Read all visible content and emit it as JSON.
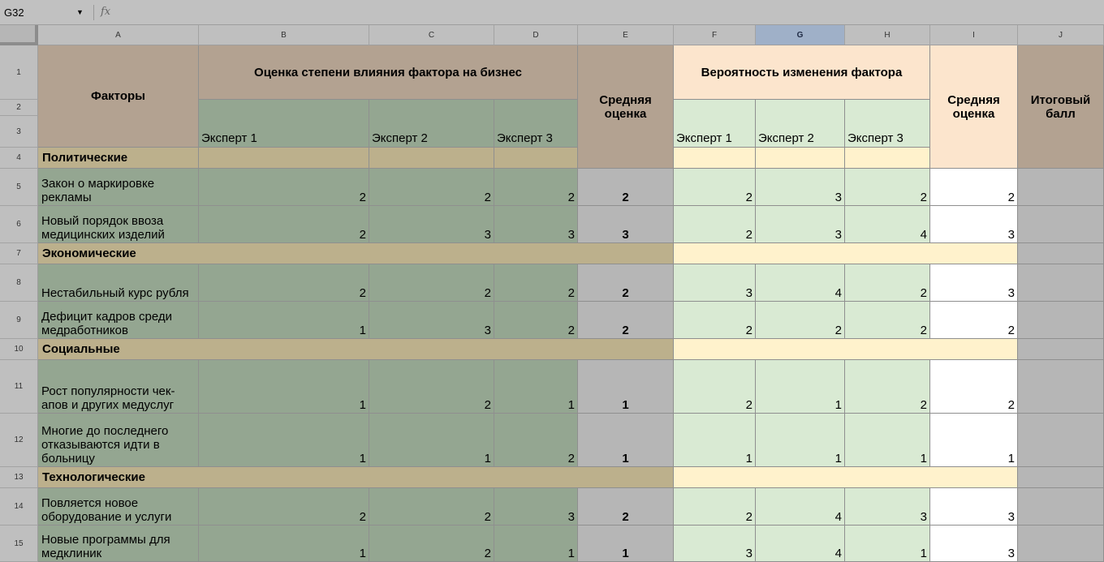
{
  "formula_bar": {
    "name_box": "G32",
    "fx": "fx",
    "formula": ""
  },
  "columns": [
    "A",
    "B",
    "C",
    "D",
    "E",
    "F",
    "G",
    "H",
    "I",
    "J"
  ],
  "rows": [
    "1",
    "2",
    "3",
    "4",
    "5",
    "6",
    "7",
    "8",
    "9",
    "10",
    "11",
    "12",
    "13",
    "14",
    "15"
  ],
  "header": {
    "factors": "Факторы",
    "impact_title": "Оценка степени влияния фактора на бизнес",
    "probability_title": "Вероятность изменения фактора",
    "average_1": "Средняя оценка",
    "average_2": "Средняя оценка",
    "total": "Итоговый балл",
    "expert_1": "Эксперт 1",
    "expert_2": "Эксперт 2",
    "expert_3": "Эксперт 3"
  },
  "categories": {
    "political": "Политические",
    "economic": "Экономические",
    "social": "Социальные",
    "technological": "Технологические"
  },
  "factors": [
    {
      "name": "Закон о маркировке рекламы",
      "impact": [
        "2",
        "2",
        "2"
      ],
      "avg_impact": "2",
      "prob": [
        "2",
        "3",
        "2"
      ],
      "avg_prob": "2"
    },
    {
      "name": "Новый порядок ввоза медицинских изделий",
      "impact": [
        "2",
        "3",
        "3"
      ],
      "avg_impact": "3",
      "prob": [
        "2",
        "3",
        "4"
      ],
      "avg_prob": "3"
    },
    {
      "name": "Нестабильный курс рубля",
      "impact": [
        "2",
        "2",
        "2"
      ],
      "avg_impact": "2",
      "prob": [
        "3",
        "4",
        "2"
      ],
      "avg_prob": "3"
    },
    {
      "name": "Дефицит кадров среди медработников",
      "impact": [
        "1",
        "3",
        "2"
      ],
      "avg_impact": "2",
      "prob": [
        "2",
        "2",
        "2"
      ],
      "avg_prob": "2"
    },
    {
      "name": "Рост популярности чек-апов и других медуслуг",
      "impact": [
        "1",
        "2",
        "1"
      ],
      "avg_impact": "1",
      "prob": [
        "2",
        "1",
        "2"
      ],
      "avg_prob": "2"
    },
    {
      "name": "Многие до последнего отказываются идти в больницу",
      "impact": [
        "1",
        "1",
        "2"
      ],
      "avg_impact": "1",
      "prob": [
        "1",
        "1",
        "1"
      ],
      "avg_prob": "1"
    },
    {
      "name": "Повляется новое оборудование и услуги",
      "impact": [
        "2",
        "2",
        "3"
      ],
      "avg_impact": "2",
      "prob": [
        "2",
        "4",
        "3"
      ],
      "avg_prob": "3"
    },
    {
      "name": "Новые программы для медклиник",
      "impact": [
        "1",
        "2",
        "1"
      ],
      "avg_impact": "1",
      "prob": [
        "3",
        "4",
        "1"
      ],
      "avg_prob": "3"
    }
  ]
}
